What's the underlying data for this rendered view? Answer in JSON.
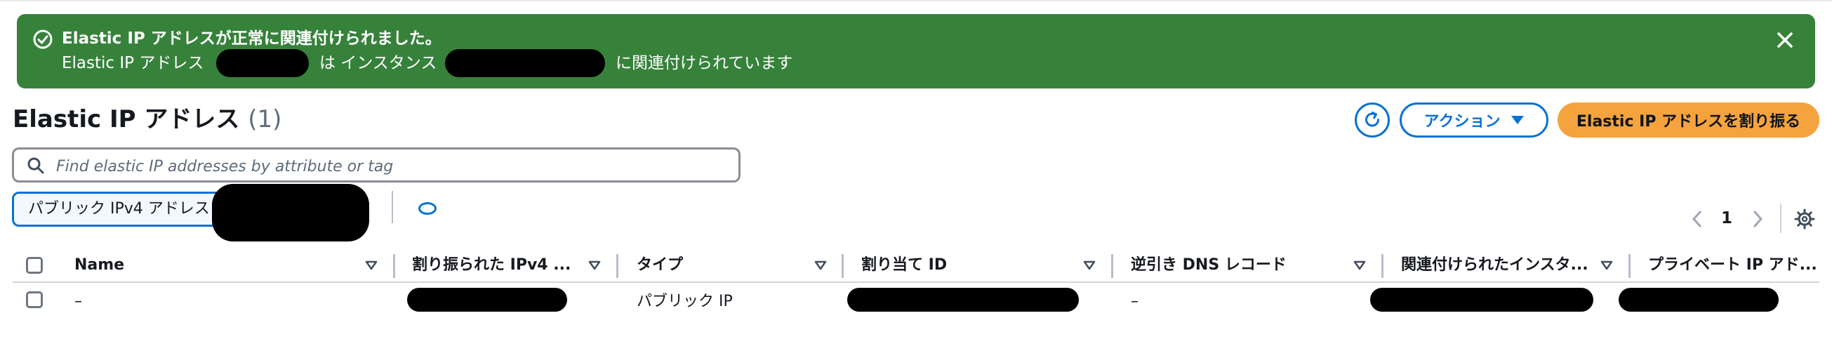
{
  "flash": {
    "title": "Elastic IP アドレスが正常に関連付けられました。",
    "detail_prefix": "Elastic IP アドレス",
    "detail_middle": "は インスタンス",
    "detail_suffix": "に関連付けられています",
    "close_label": "×"
  },
  "header": {
    "title": "Elastic IP アドレス",
    "count": "(1)",
    "actions_label": "アクション",
    "allocate_label": "Elastic IP アドレスを割り振る"
  },
  "search": {
    "placeholder": "Find elastic IP addresses by attribute or tag"
  },
  "filter": {
    "token_label": "パブリック IPv4 アドレス"
  },
  "pagination": {
    "current_page": "1"
  },
  "table": {
    "columns": [
      "Name",
      "割り振られた IPv4 ...",
      "タイプ",
      "割り当て ID",
      "逆引き DNS レコード",
      "関連付けられたインスタ...",
      "プライベート IP アド..."
    ],
    "rows": [
      {
        "name": "–",
        "type": "パブリック IP",
        "reverse_dns": "–"
      }
    ]
  },
  "colors": {
    "success": "#37823b",
    "primary": "#f5a33e",
    "link": "#0972d3"
  }
}
